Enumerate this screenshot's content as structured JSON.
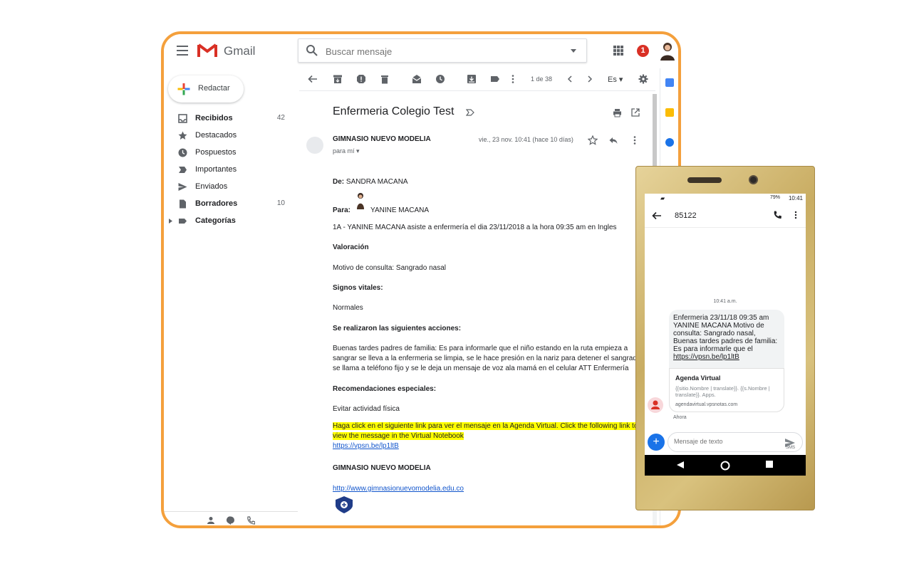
{
  "gmail": {
    "app_name": "Gmail",
    "notifications": "1",
    "search": {
      "placeholder": "Buscar mensaje",
      "value": ""
    },
    "compose_label": "Redactar",
    "sidebar": [
      {
        "label": "Recibidos",
        "count": "42",
        "bold": true,
        "icon": "inbox-icon"
      },
      {
        "label": "Destacados",
        "count": "",
        "bold": false,
        "icon": "star-icon"
      },
      {
        "label": "Pospuestos",
        "count": "",
        "bold": false,
        "icon": "clock-icon"
      },
      {
        "label": "Importantes",
        "count": "",
        "bold": false,
        "icon": "important-icon"
      },
      {
        "label": "Enviados",
        "count": "",
        "bold": false,
        "icon": "send-icon"
      },
      {
        "label": "Borradores",
        "count": "10",
        "bold": true,
        "icon": "draft-icon"
      },
      {
        "label": "Categorías",
        "count": "",
        "bold": true,
        "icon": "label-icon"
      }
    ],
    "toolbar": {
      "pager": "1 de 38",
      "language": "Es"
    },
    "message": {
      "subject": "Enfermeria Colegio Test",
      "sender": "GIMNASIO NUEVO MODELIA",
      "to": "para mí",
      "date": "vie., 23 nov. 10:41 (hace 10 días)",
      "de_label": "De:",
      "de_value": "SANDRA MACANA",
      "para_label": "Para:",
      "para_value": "YANINE MACANA",
      "line1": "1A - YANINE MACANA asiste a enfermería el dia 23/11/2018 a la hora 09:35 am en Ingles",
      "valoracion": "Valoración",
      "motivo": "Motivo de consulta: Sangrado nasal",
      "signos": "Signos vitales:",
      "normales": "Normales",
      "acciones": "Se realizaron las siguientes acciones:",
      "acciones_text1": "Buenas tardes padres de familia: Es para informarle que el niño estando en la ruta empieza a",
      "acciones_text2": "sangrar se lleva a la enfermeria se limpia, se le hace presión en la nariz para detener el sangrado",
      "acciones_text3": "se llama a teléfono fijo y se le deja un mensaje de voz ala mamá en el celular ATT Enfermería",
      "recomendaciones": "Recomendaciones especiales:",
      "evitar": "Evitar actividad física",
      "highlight1": "Haga click en el siguiente link para ver el mensaje en la Agenda Virtual. Click the following link to",
      "highlight2": "view the message in the Virtual Notebook",
      "short_link": "https://vpsn.be/lp1ltB",
      "signature": "GIMNASIO NUEVO MODELIA",
      "website": "http://www.gimnasionuevomodelia.edu.co"
    }
  },
  "phone": {
    "status_battery": "79%",
    "status_time": "10:41",
    "contact": "85122",
    "timestamp": "10:41 a.m.",
    "sms_text": "Enfermeria 23/11/18 09:35 am YANINE MACANA Motivo de consulta: Sangrado nasal, Buenas tardes padres de familia: Es para informarle que el ",
    "sms_link": "https://vpsn.be/lp1ltB",
    "preview_title": "Agenda Virtual",
    "preview_desc": "{{sitio.Nombre | translate}}. {{s.Nombre | translate}}. Apps.",
    "preview_url": "agendavirtual.vpsnotas.com",
    "sent_label": "Ahora",
    "composer_placeholder": "Mensaje de texto",
    "send_label": "SMS"
  },
  "colors": {
    "accent_frame": "#f4a03c",
    "gmail_red": "#d93025",
    "highlight": "#ffff00",
    "link": "#1155cc",
    "phone_gold": "#c9ad63"
  }
}
